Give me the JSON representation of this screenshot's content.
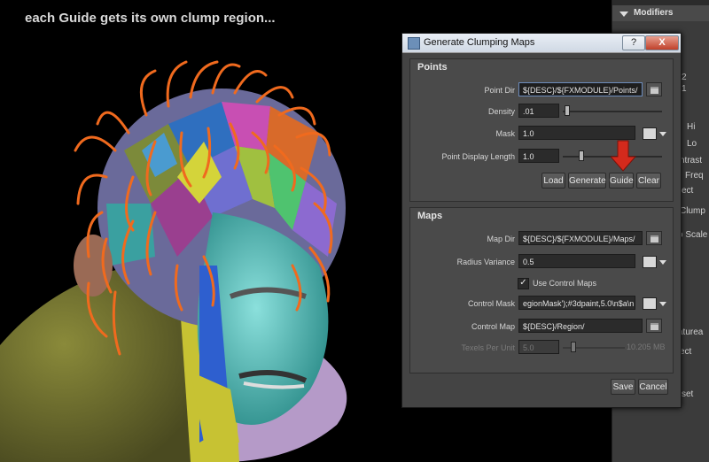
{
  "viewport": {
    "caption": "each Guide gets its own clump region..."
  },
  "side_panel": {
    "header": "Modifiers",
    "labels": [
      "2",
      "1",
      "Hi",
      "Lo",
      "ntrast",
      "Freq",
      "ect",
      "Clump",
      "o Scale",
      "aturea",
      "ect",
      "set"
    ]
  },
  "dialog": {
    "title": "Generate Clumping Maps",
    "help_label": "?",
    "close_label": "X",
    "points": {
      "title": "Points",
      "point_dir_label": "Point Dir",
      "point_dir_value": "${DESC}/${FXMODULE}/Points/",
      "density_label": "Density",
      "density_value": ".01",
      "mask_label": "Mask",
      "mask_value": "1.0",
      "display_length_label": "Point Display Length",
      "display_length_value": "1.0",
      "buttons": [
        "Load",
        "Generate",
        "Guide",
        "Clear"
      ]
    },
    "maps": {
      "title": "Maps",
      "map_dir_label": "Map Dir",
      "map_dir_value": "${DESC}/${FXMODULE}/Maps/",
      "radius_variance_label": "Radius Variance",
      "radius_variance_value": "0.5",
      "use_control_maps_label": "Use Control Maps",
      "use_control_maps_checked": true,
      "control_mask_label": "Control Mask",
      "control_mask_value": "egionMask');#3dpaint,5.0\\n$a\\n",
      "control_map_label": "Control Map",
      "control_map_value": "${DESC}/Region/",
      "texels_label": "Texels Per Unit",
      "texels_value": "5.0",
      "memory_readout": "10.205 MB"
    },
    "save_label": "Save",
    "cancel_label": "Cancel",
    "colors": {
      "accent_arrow": "#d42a1c",
      "guide_hair": "#f06a1e"
    }
  }
}
